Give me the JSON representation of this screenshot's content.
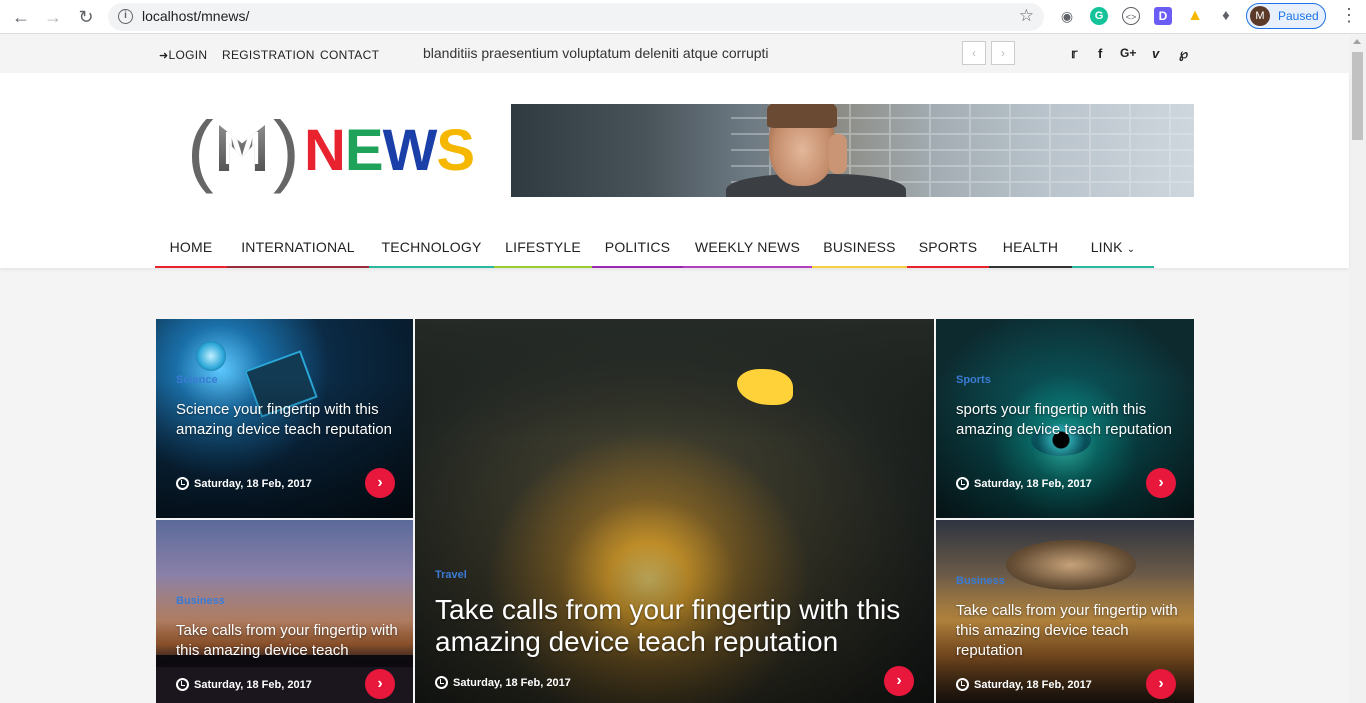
{
  "browser": {
    "url": "localhost/mnews/",
    "profile_initial": "M",
    "profile_status": "Paused"
  },
  "topbar": {
    "links": [
      "LOGIN",
      "REGISTRATION",
      "CONTACT"
    ],
    "ticker": "blanditiis praesentium voluptatum deleniti atque corrupti",
    "social": [
      "twitter-icon",
      "facebook-icon",
      "google-plus-icon",
      "vimeo-icon",
      "pinterest-icon"
    ]
  },
  "logo": {
    "paren_left": "(",
    "paren_right": ")",
    "m": "M",
    "news": [
      "N",
      "E",
      "W",
      "S"
    ],
    "news_colors": [
      "#e8232f",
      "#1fa35b",
      "#1b3fa8",
      "#f5b700"
    ]
  },
  "nav": {
    "items": [
      {
        "label": "HOME",
        "color": "#e8232f"
      },
      {
        "label": "INTERNATIONAL",
        "color": "#9c2b3c"
      },
      {
        "label": "TECHNOLOGY",
        "color": "#2ab7a0"
      },
      {
        "label": "LIFESTYLE",
        "color": "#9acd32"
      },
      {
        "label": "POLITICS",
        "color": "#9c27b0"
      },
      {
        "label": "WEEKLY NEWS",
        "color": "#b13fc0"
      },
      {
        "label": "BUSINESS",
        "color": "#f5d142"
      },
      {
        "label": "SPORTS",
        "color": "#e8232f"
      },
      {
        "label": "HEALTH",
        "color": "#333333"
      },
      {
        "label": "LINK",
        "color": "#2ab7a0"
      }
    ]
  },
  "tiles": {
    "t1": {
      "category": "Science",
      "title": "Science your fingertip with this amazing device teach reputation",
      "date": "Saturday, 18 Feb, 2017"
    },
    "t2": {
      "category": "Business",
      "title": "Take calls from your fingertip with this amazing device teach",
      "date": "Saturday, 18 Feb, 2017"
    },
    "main": {
      "category": "Travel",
      "title": "Take calls from your fingertip with this amazing device teach reputation",
      "date": "Saturday, 18 Feb, 2017"
    },
    "t3": {
      "category": "Sports",
      "title": "sports your fingertip with this amazing device teach reputation",
      "date": "Saturday, 18 Feb, 2017"
    },
    "t4": {
      "category": "Business",
      "title": "Take calls from your fingertip with this amazing device teach reputation",
      "date": "Saturday, 18 Feb, 2017"
    }
  }
}
